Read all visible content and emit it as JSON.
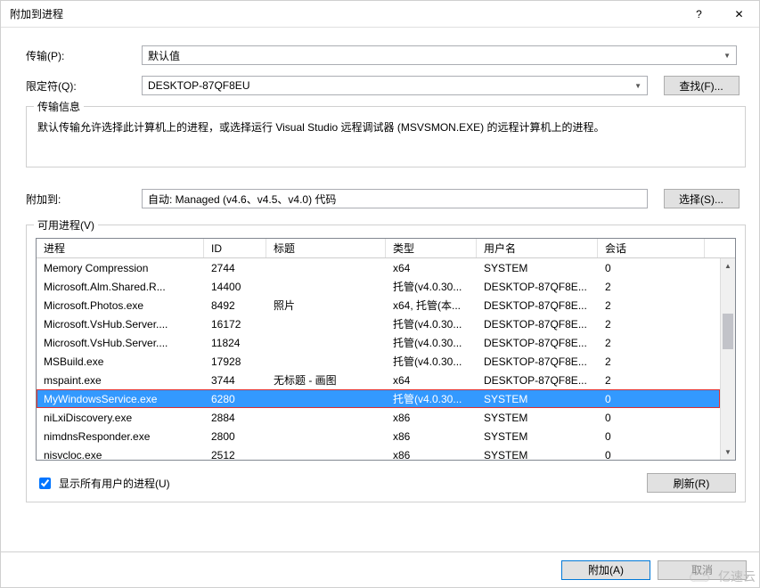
{
  "window": {
    "title": "附加到进程",
    "help": "?",
    "close": "✕"
  },
  "transport": {
    "label": "传输(P):",
    "value": "默认值"
  },
  "qualifier": {
    "label": "限定符(Q):",
    "value": "DESKTOP-87QF8EU",
    "find_btn": "查找(F)..."
  },
  "transport_info": {
    "legend": "传输信息",
    "text": "默认传输允许选择此计算机上的进程，或选择运行 Visual Studio 远程调试器 (MSVSMON.EXE) 的远程计算机上的进程。"
  },
  "attach_to": {
    "label": "附加到:",
    "value": "自动: Managed (v4.6、v4.5、v4.0) 代码",
    "select_btn": "选择(S)..."
  },
  "process_list": {
    "legend": "可用进程(V)",
    "columns": {
      "process": "进程",
      "id": "ID",
      "title": "标题",
      "type": "类型",
      "user": "用户名",
      "session": "会话"
    },
    "rows": [
      {
        "process": "Memory Compression",
        "id": "2744",
        "title": "",
        "type": "x64",
        "user": "SYSTEM",
        "session": "0",
        "selected": false
      },
      {
        "process": "Microsoft.Alm.Shared.R...",
        "id": "14400",
        "title": "",
        "type": "托管(v4.0.30...",
        "user": "DESKTOP-87QF8E...",
        "session": "2",
        "selected": false
      },
      {
        "process": "Microsoft.Photos.exe",
        "id": "8492",
        "title": "照片",
        "type": "x64, 托管(本...",
        "user": "DESKTOP-87QF8E...",
        "session": "2",
        "selected": false
      },
      {
        "process": "Microsoft.VsHub.Server....",
        "id": "16172",
        "title": "",
        "type": "托管(v4.0.30...",
        "user": "DESKTOP-87QF8E...",
        "session": "2",
        "selected": false
      },
      {
        "process": "Microsoft.VsHub.Server....",
        "id": "11824",
        "title": "",
        "type": "托管(v4.0.30...",
        "user": "DESKTOP-87QF8E...",
        "session": "2",
        "selected": false
      },
      {
        "process": "MSBuild.exe",
        "id": "17928",
        "title": "",
        "type": "托管(v4.0.30...",
        "user": "DESKTOP-87QF8E...",
        "session": "2",
        "selected": false
      },
      {
        "process": "mspaint.exe",
        "id": "3744",
        "title": "无标题 - 画图",
        "type": "x64",
        "user": "DESKTOP-87QF8E...",
        "session": "2",
        "selected": false
      },
      {
        "process": "MyWindowsService.exe",
        "id": "6280",
        "title": "",
        "type": "托管(v4.0.30...",
        "user": "SYSTEM",
        "session": "0",
        "selected": true
      },
      {
        "process": "niLxiDiscovery.exe",
        "id": "2884",
        "title": "",
        "type": "x86",
        "user": "SYSTEM",
        "session": "0",
        "selected": false
      },
      {
        "process": "nimdnsResponder.exe",
        "id": "2800",
        "title": "",
        "type": "x86",
        "user": "SYSTEM",
        "session": "0",
        "selected": false
      },
      {
        "process": "nisvcloc.exe",
        "id": "2512",
        "title": "",
        "type": "x86",
        "user": "SYSTEM",
        "session": "0",
        "selected": false
      }
    ],
    "show_all_users": "显示所有用户的进程(U)",
    "refresh_btn": "刷新(R)"
  },
  "buttons": {
    "attach": "附加(A)",
    "cancel": "取消"
  },
  "watermark": "亿速云"
}
